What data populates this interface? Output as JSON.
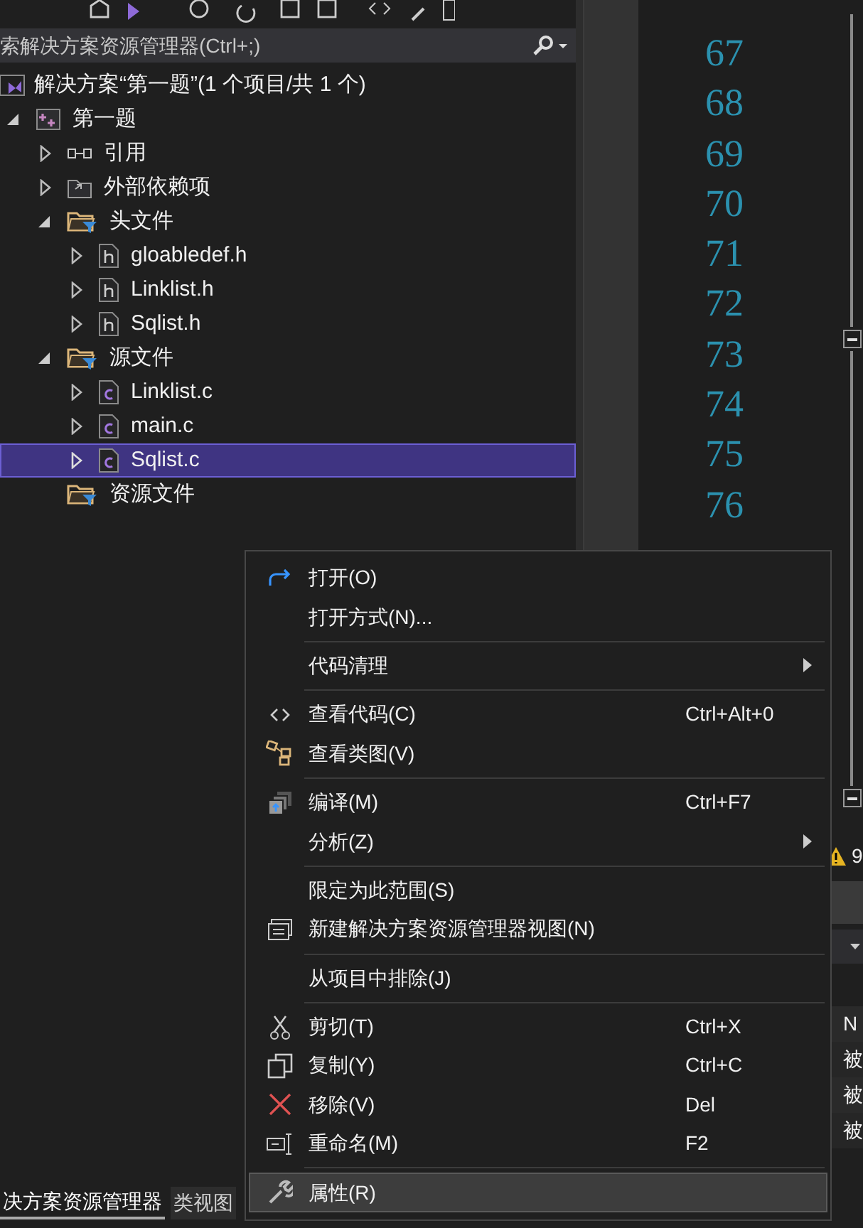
{
  "search": {
    "placeholder": "索解决方案资源管理器(Ctrl+;)"
  },
  "solution": {
    "label": "解决方案“第一题”(1 个项目/共 1 个)"
  },
  "tree": [
    {
      "label": "第一题",
      "kind": "project",
      "expanded": true,
      "selected": false,
      "children": [
        {
          "label": "引用",
          "kind": "references",
          "expanded": false,
          "selected": false
        },
        {
          "label": "外部依赖项",
          "kind": "dependencies",
          "expanded": false,
          "selected": false
        },
        {
          "label": "头文件",
          "kind": "filter",
          "expanded": true,
          "selected": false,
          "children": [
            {
              "label": "gloabledef.h",
              "kind": "header",
              "expanded": false,
              "selected": false
            },
            {
              "label": "Linklist.h",
              "kind": "header",
              "expanded": false,
              "selected": false
            },
            {
              "label": "Sqlist.h",
              "kind": "header",
              "expanded": false,
              "selected": false
            }
          ]
        },
        {
          "label": "源文件",
          "kind": "filter",
          "expanded": true,
          "selected": false,
          "children": [
            {
              "label": "Linklist.c",
              "kind": "source",
              "expanded": false,
              "selected": false
            },
            {
              "label": "main.c",
              "kind": "source",
              "expanded": false,
              "selected": false
            },
            {
              "label": "Sqlist.c",
              "kind": "source",
              "expanded": false,
              "selected": true
            }
          ]
        },
        {
          "label": "资源文件",
          "kind": "filter",
          "selected": false
        }
      ]
    }
  ],
  "line_numbers": [
    "67",
    "68",
    "69",
    "70",
    "71",
    "72",
    "73",
    "74",
    "75",
    "76"
  ],
  "output_panel": {
    "warning_count": "9",
    "rows": [
      "N",
      "被",
      "被",
      "被"
    ]
  },
  "bottom_tabs": [
    {
      "label": "决方案资源管理器",
      "selected": true
    },
    {
      "label": "类视图",
      "selected": false
    }
  ],
  "context_menu": [
    {
      "kind": "item",
      "label": "打开(O)",
      "selected": false
    },
    {
      "kind": "item",
      "label": "打开方式(N)...",
      "selected": false
    },
    {
      "kind": "separator"
    },
    {
      "kind": "item",
      "label": "代码清理",
      "submenu": true,
      "selected": false
    },
    {
      "kind": "separator"
    },
    {
      "kind": "item",
      "label": "查看代码(C)",
      "shortcut": "Ctrl+Alt+0",
      "selected": false
    },
    {
      "kind": "item",
      "label": "查看类图(V)",
      "selected": false
    },
    {
      "kind": "separator"
    },
    {
      "kind": "item",
      "label": "编译(M)",
      "shortcut": "Ctrl+F7",
      "selected": false
    },
    {
      "kind": "item",
      "label": "分析(Z)",
      "submenu": true,
      "selected": false
    },
    {
      "kind": "separator"
    },
    {
      "kind": "item",
      "label": "限定为此范围(S)",
      "selected": false
    },
    {
      "kind": "item",
      "label": "新建解决方案资源管理器视图(N)",
      "selected": false
    },
    {
      "kind": "separator"
    },
    {
      "kind": "item",
      "label": "从项目中排除(J)",
      "selected": false
    },
    {
      "kind": "separator"
    },
    {
      "kind": "item",
      "label": "剪切(T)",
      "shortcut": "Ctrl+X",
      "selected": false
    },
    {
      "kind": "item",
      "label": "复制(Y)",
      "shortcut": "Ctrl+C",
      "selected": false
    },
    {
      "kind": "item",
      "label": "移除(V)",
      "shortcut": "Del",
      "selected": false
    },
    {
      "kind": "item",
      "label": "重命名(M)",
      "shortcut": "F2",
      "selected": false
    },
    {
      "kind": "separator"
    },
    {
      "kind": "item",
      "label": "属性(R)",
      "selected": true
    }
  ]
}
